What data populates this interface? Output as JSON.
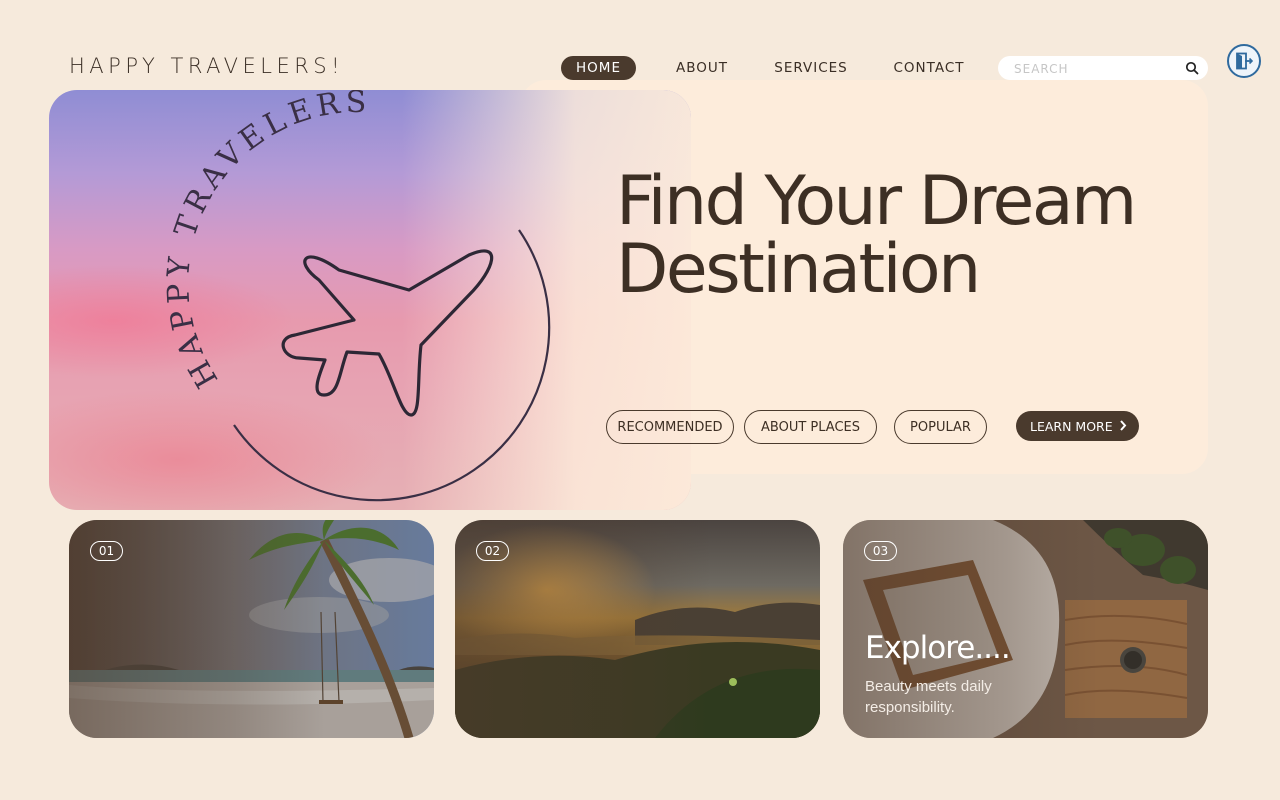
{
  "brand": "HAPPY TRAVELERS!",
  "nav": [
    {
      "label": "HOME",
      "active": true
    },
    {
      "label": "ABOUT",
      "active": false
    },
    {
      "label": "SERVICES",
      "active": false
    },
    {
      "label": "CONTACT",
      "active": false
    }
  ],
  "search": {
    "placeholder": "SEARCH"
  },
  "hero": {
    "logo_text": "HAPPY TRAVELERS",
    "headline_line1": "Find Your Dream",
    "headline_line2": "Destination",
    "pills": [
      "RECOMMENDED",
      "ABOUT PLACES",
      "POPULAR"
    ],
    "cta": "LEARN MORE"
  },
  "cards": [
    {
      "number": "01"
    },
    {
      "number": "02"
    },
    {
      "number": "03",
      "title": "Explore....",
      "subtitle": "Beauty meets daily responsibility."
    }
  ],
  "colors": {
    "background": "#f6eadc",
    "panel": "#fdecdb",
    "accent_dark": "#4a3a2d",
    "logout_blue": "#2f6a9e"
  }
}
